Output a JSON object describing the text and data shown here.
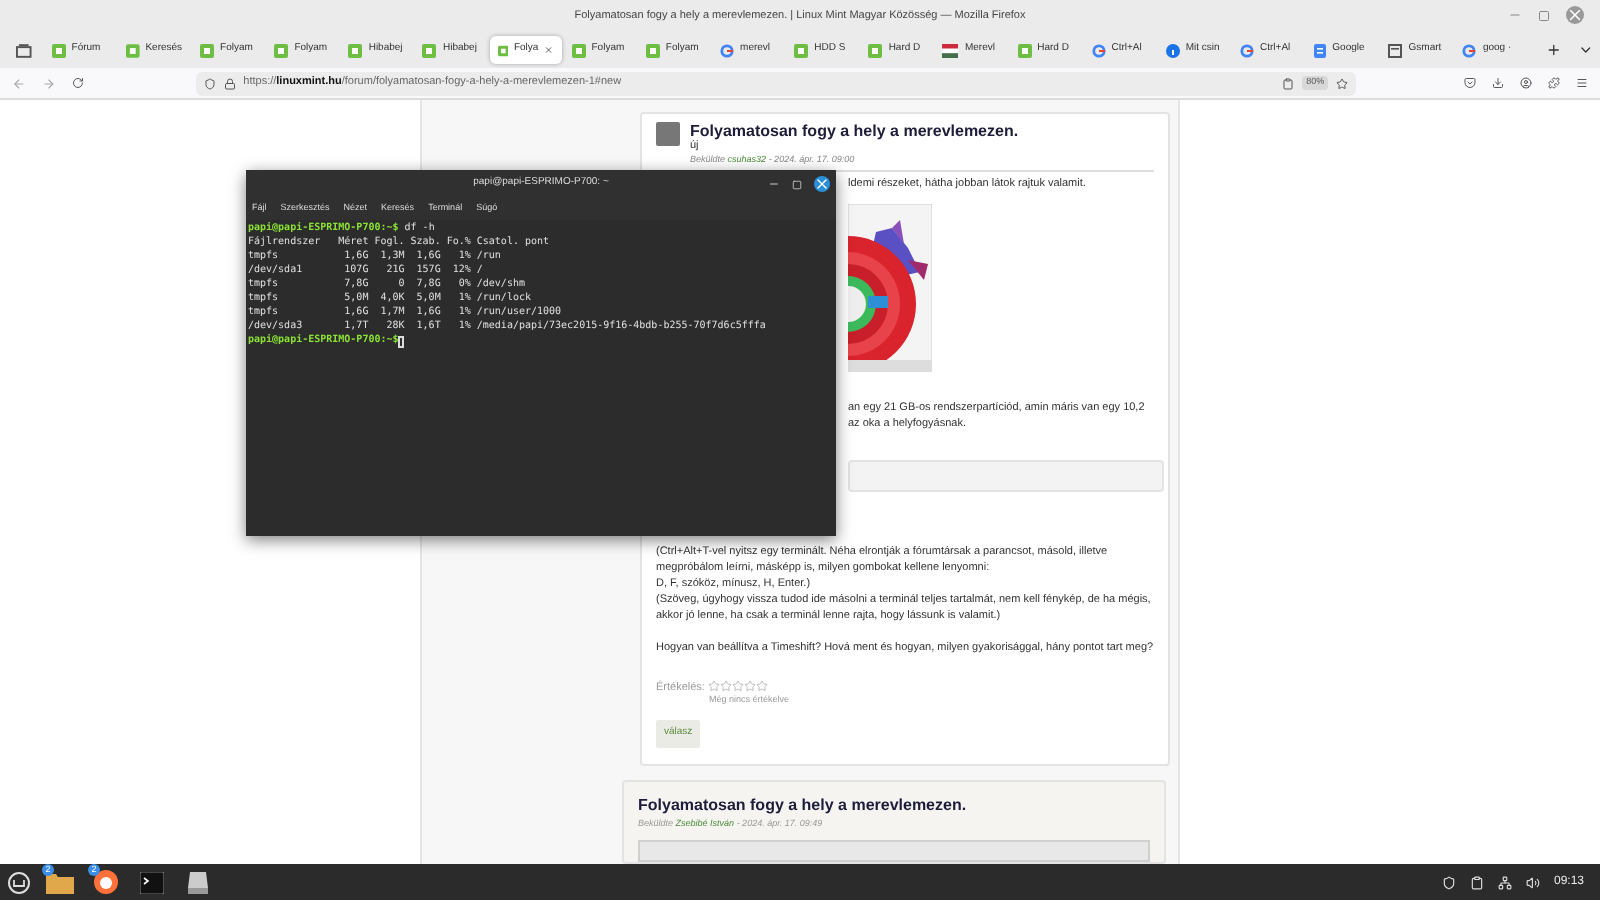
{
  "browser": {
    "title": "Folyamatosan fogy a hely a merevlemezen. | Linux Mint Magyar Közösség — Mozilla Firefox",
    "tabs": [
      {
        "label": "Fórum",
        "selected": false,
        "kind": "mint"
      },
      {
        "label": "Keresés",
        "selected": false,
        "kind": "mint"
      },
      {
        "label": "Folyam",
        "selected": false,
        "kind": "mint"
      },
      {
        "label": "Folyam",
        "selected": false,
        "kind": "mint"
      },
      {
        "label": "Hibabej",
        "selected": false,
        "kind": "mint"
      },
      {
        "label": "Hibabej",
        "selected": false,
        "kind": "mint"
      },
      {
        "label": "Folya",
        "selected": true,
        "kind": "mint"
      },
      {
        "label": "Folyam",
        "selected": false,
        "kind": "mint"
      },
      {
        "label": "Folyam",
        "selected": false,
        "kind": "mint"
      },
      {
        "label": "merevl",
        "selected": false,
        "kind": "google"
      },
      {
        "label": "HDD S",
        "selected": false,
        "kind": "mint"
      },
      {
        "label": "Hard D",
        "selected": false,
        "kind": "mint"
      },
      {
        "label": "Merevl",
        "selected": false,
        "kind": "flag"
      },
      {
        "label": "Hard D",
        "selected": false,
        "kind": "mint"
      },
      {
        "label": "Ctrl+Al",
        "selected": false,
        "kind": "google"
      },
      {
        "label": "Mit csin",
        "selected": false,
        "kind": "info"
      },
      {
        "label": "Ctrl+Al",
        "selected": false,
        "kind": "google"
      },
      {
        "label": "Google",
        "selected": false,
        "kind": "docs"
      },
      {
        "label": "Gsmart",
        "selected": false,
        "kind": "page"
      },
      {
        "label": "goog ·",
        "selected": false,
        "kind": "google"
      }
    ],
    "url": {
      "scheme": "https://",
      "domain": "linuxmint.hu",
      "path": "/forum/folyamatosan-fogy-a-hely-a-merevlemezen-1#new"
    },
    "zoom": "80%"
  },
  "terminal": {
    "title": "papi@papi-ESPRIMO-P700: ~",
    "menu": [
      "Fájl",
      "Szerkesztés",
      "Nézet",
      "Keresés",
      "Terminál",
      "Súgó"
    ],
    "lines": [
      {
        "kind": "prompt",
        "prompt": "papi@papi-ESPRIMO-P700:~$",
        "command": " df -h",
        "cursor": false
      },
      {
        "kind": "output",
        "text": "Fájlrendszer   Méret Fogl. Szab. Fo.% Csatol. pont"
      },
      {
        "kind": "output",
        "text": "tmpfs           1,6G  1,3M  1,6G   1% /run"
      },
      {
        "kind": "output",
        "text": "/dev/sda1       107G   21G  157G  12% /"
      },
      {
        "kind": "output",
        "text": "tmpfs           7,8G     0  7,8G   0% /dev/shm"
      },
      {
        "kind": "output",
        "text": "tmpfs           5,0M  4,0K  5,0M   1% /run/lock"
      },
      {
        "kind": "output",
        "text": "tmpfs           1,6G  1,7M  1,6G   1% /run/user/1000"
      },
      {
        "kind": "output",
        "text": "/dev/sda3       1,7T   28K  1,6T   1% /media/papi/73ec2015-9f16-4bdb-b255-70f7d6c5fffa"
      },
      {
        "kind": "prompt",
        "prompt": "papi@papi-ESPRIMO-P700:~$",
        "cursor": true
      }
    ]
  },
  "posts": [
    {
      "title": "Folyamatosan fogy a hely a merevlemezen.",
      "new_label": "új",
      "byline": {
        "prefix": "Beküldte",
        "author": "csuhas32",
        "date": "- 2024. ápr. 17. 09:00"
      },
      "partial_lines": [
        "ldemi részeket, hátha jobban látok rajtuk valamit."
      ],
      "partial_lines_2": [
        "an egy 21 GB-os rendszerpartíciód, amin máris van egy 10,2",
        "az oka a helyfogyásnak."
      ],
      "paragraphs": [
        {
          "lines": [
            "(Ctrl+Alt+T-vel nyitsz egy terminált. Néha elrontják a fórumtársak a parancsot, másold, illetve megpróbálom leírni, másképp is, milyen gombokat kellene lenyomni:",
            "D, F, szóköz, mínusz, H, Enter.)",
            "(Szöveg, úgyhogy vissza tudod ide másolni a terminál teljes tartalmát, nem kell fénykép, de ha mégis, akkor jó lenne, ha csak a terminál lenne rajta, hogy lássunk is valamit.)"
          ]
        },
        {
          "lines": [
            "Hogyan van beállítva a Timeshift? Hová ment és hogyan, milyen gyakorisággal, hány pontot tart meg?"
          ]
        }
      ],
      "rating": {
        "label": "Értékelés:",
        "stars": 0,
        "note": "Még nincs értékelve"
      },
      "reply_button": "válasz"
    },
    {
      "title": "Folyamatosan fogy a hely a merevlemezen.",
      "byline": {
        "prefix": "Beküldte",
        "author": "Zsebibé István",
        "date": "- 2024. ápr. 17. 09:49"
      }
    }
  ],
  "taskbar": {
    "apps": [
      {
        "kind": "files",
        "badge": "2"
      },
      {
        "kind": "firefox",
        "badge": "2"
      },
      {
        "kind": "terminal"
      },
      {
        "kind": "drive"
      }
    ],
    "clock": "09:13"
  }
}
